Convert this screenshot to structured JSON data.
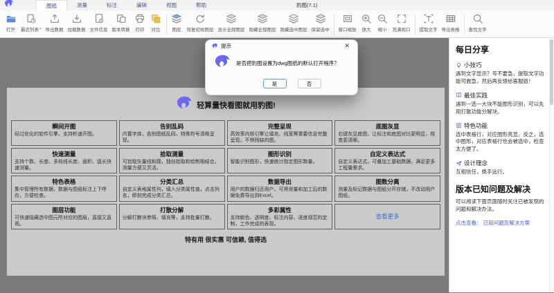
{
  "window": {
    "title": "豹图(7.1)"
  },
  "tabs": [
    {
      "label": "图纸",
      "active": true
    },
    {
      "label": "测量",
      "active": false
    },
    {
      "label": "标注",
      "active": false
    },
    {
      "label": "编辑",
      "active": false
    },
    {
      "label": "视图",
      "active": false
    },
    {
      "label": "帮助",
      "active": false
    }
  ],
  "toolbar": {
    "groups": [
      {
        "items": [
          {
            "name": "open",
            "icon": "folder-icon",
            "label": "打开"
          },
          {
            "name": "recent-list",
            "icon": "recent-icon",
            "label": "最近列表",
            "caret": "▾"
          },
          {
            "name": "export-data",
            "icon": "export-icon",
            "label": "导出数据"
          },
          {
            "name": "load-data",
            "icon": "load-icon",
            "label": "加载数据"
          },
          {
            "name": "file-info",
            "icon": "fileinfo-icon",
            "label": "文件信息"
          },
          {
            "name": "version-convert",
            "icon": "convert-icon",
            "label": "版本转换"
          },
          {
            "name": "print",
            "icon": "print-icon",
            "label": "打印"
          },
          {
            "name": "compare",
            "icon": "compare-icon",
            "label": "对比"
          }
        ]
      },
      {
        "items": [
          {
            "name": "layers",
            "icon": "layers-blue-icon",
            "label": "图层"
          },
          {
            "name": "restore-layers",
            "icon": "restore-icon",
            "label": "恢复初始图层"
          },
          {
            "name": "show-all-layers",
            "icon": "layers-icon",
            "label": "显示全部图层"
          },
          {
            "name": "hide-all-layers",
            "icon": "layers-icon",
            "label": "隐藏全部图层"
          },
          {
            "name": "hide-selected-layers",
            "icon": "layers-light-icon",
            "label": "隐藏选中图层"
          },
          {
            "name": "keep-selected",
            "icon": "layers-icon",
            "label": "保留选中"
          }
        ]
      },
      {
        "items": [
          {
            "name": "window-zoom",
            "icon": "zoomwin-icon",
            "label": "窗口缩放"
          },
          {
            "name": "zoom-in",
            "icon": "zoomin-icon",
            "label": "放大"
          },
          {
            "name": "zoom-out",
            "icon": "zoomout-icon",
            "label": "缩小"
          },
          {
            "name": "fit-viewport",
            "icon": "fit-icon",
            "label": "充满视口"
          }
        ]
      },
      {
        "items": [
          {
            "name": "extract-text",
            "icon": "text-icon",
            "label": "提取文字"
          },
          {
            "name": "export-table",
            "icon": "table-icon",
            "label": "导出表格"
          }
        ]
      },
      {
        "items": [
          {
            "name": "find-text",
            "icon": "find-icon",
            "label": "查找文字"
          }
        ]
      }
    ]
  },
  "dialog": {
    "title": "提示",
    "close": "✕",
    "message": "是否把豹图设置为dwg图纸的默认打开程序？",
    "yes_label": "是",
    "no_label": "否"
  },
  "promo": {
    "headline": "轻算量快看图就用豹图!",
    "cards": [
      {
        "title": "瞬间开图",
        "desc": "经过优化的软件引擎，支持秒速开图。"
      },
      {
        "title": "告别乱码",
        "desc": "内置字库，告别图纸乱码，特殊符号清晰呈现。"
      },
      {
        "title": "完整呈现",
        "desc": "高效率内核引擎让填充、线宽等重要信息完整呈现，不惧残缺的图。"
      },
      {
        "title": "底图灰显",
        "desc": "右键灰显底图，让标注和底图对比更明显，核查更清晰。"
      },
      {
        "title": "快速测量",
        "desc": "支持个数、长度、多段线长度、面积、弧长快速测量。"
      },
      {
        "title": "拾取测量",
        "desc": "可拾取矢量线和圆，独创拾取和绘制相结合，测量方便又灵活。"
      },
      {
        "title": "图形识别",
        "desc": "智能识别图形，快速统计指定图形数量。"
      },
      {
        "title": "自定义表达式",
        "desc": "自定义表达式，可叠加工基础数据，满足更多工程量需求。"
      },
      {
        "title": "特色表格",
        "desc": "集中管理所有数据，数据与图纸标注上下呼应，方便检查。"
      },
      {
        "title": "分类汇总",
        "desc": "自定义表格属性列，填入分类属性值，点击列名，即刻完成分类汇总。"
      },
      {
        "title": "数据导出",
        "desc": "用户的数据归还用户，可将测量和加工后的数据免费导出到Excel。"
      },
      {
        "title": "图数分离",
        "desc": "测量及标记数据与图纸分开存储，不改动用户图纸。"
      },
      {
        "title": "图层功能",
        "desc": "可快速隐藏选中图元所对应的图层，直接又直观。"
      },
      {
        "title": "打散分解",
        "desc": "分解打散块参照、填充等，支持批量打散。"
      },
      {
        "title": "多彩属性",
        "desc": "支持颜色、透明度、标注内容、进度规范的定制，工作完成的表现。"
      },
      {
        "link": "查看更多"
      }
    ],
    "tagline": "特有用 很实惠 可信赖, 值得选"
  },
  "sidebar": {
    "title": "每日分享",
    "sections": [
      {
        "icon": "bulb-icon",
        "label": "小技巧",
        "text": "遇到文字显示？号不要急，提取文字功能可救急，然后再反馈给客服姐！"
      },
      {
        "icon": "book-icon",
        "label": "最佳实践",
        "text": "遇到一选一大块不能图形识别，可以先用打散功能分解块。"
      },
      {
        "icon": "doc-icon",
        "label": "特色功能",
        "text": "选中表格行，对应图形亮显。反之，选中图形，对应表格行也会被选中，检查太方便了。"
      },
      {
        "icon": "plane-icon",
        "label": "设计理念",
        "text": "互相信任，携手远行。"
      }
    ],
    "issues_title": "版本已知问题及解决",
    "issues_text": "可以阅读下面页面随时关注已被发现的问题和解决办法。",
    "issues_link": "点击查看： 已知问题及解决方案"
  },
  "colors": {
    "accent_purple": "#7b5cf0",
    "accent_blue": "#3f6ff0",
    "folder_blue": "#5a8fd6",
    "compare_yellow": "#e8c34a",
    "link_blue": "#3b6cd4",
    "canvas_gray": "#7c7c7c",
    "panel_gray": "#cacaca"
  }
}
